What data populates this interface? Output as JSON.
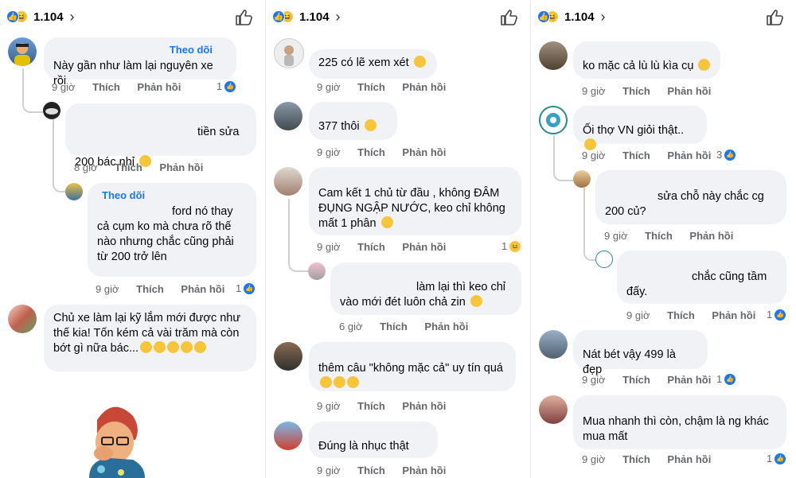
{
  "reaction_count": "1.104",
  "follow_label": "Theo dõi",
  "actions": {
    "like": "Thích",
    "reply": "Phản hồi"
  },
  "panel1": {
    "c1": {
      "text": "Này gần như làm lại nguyên xe rồi",
      "time": "9 giờ",
      "likes": "1"
    },
    "c1r1": {
      "text": "tiền sửa\n200 bác nhỉ",
      "time": "8 giờ"
    },
    "c1r2": {
      "text": "ford nó thay cả cụm ko mà chưa rõ thế nào nhưng chắc cũng phải từ 200 trở lên",
      "time": "9 giờ",
      "likes": "1"
    },
    "c2": {
      "text": "Chủ xe làm lại kỹ lắm mới được như thế kia! Tốn kém cả vài trăm mà còn bớt gì nữa bác..."
    }
  },
  "panel2": {
    "c1": {
      "text": "225 có lẽ xem xét",
      "time": "9 giờ"
    },
    "c2": {
      "text": "377 thôi",
      "time": "9 giờ"
    },
    "c3": {
      "text": "Cam kết 1 chủ từ đầu , không ĐÂM ĐỤNG NGẬP NƯỚC, keo chỉ không mất 1 phân",
      "time": "9 giờ",
      "likes": "1"
    },
    "c3r1": {
      "text": "làm lại thì keo chỉ vào mới đét luôn chả zin",
      "time": "6 giờ"
    },
    "c4": {
      "text": "thêm câu \"không mặc cả\" uy tín quá",
      "time": "9 giờ"
    },
    "c5": {
      "text": "Đúng là nhục thật",
      "time": "9 giờ"
    }
  },
  "panel3": {
    "c1": {
      "text": "ko mặc cả lù lù kìa cụ",
      "time": "9 giờ"
    },
    "c2": {
      "text": "Ối thợ VN giỏi thật..",
      "time": "9 giờ",
      "likes": "3"
    },
    "c2r1": {
      "text": "sửa chỗ này chắc cg 200 củ?",
      "time": "9 giờ"
    },
    "c2r2": {
      "text": "chắc cũng tầm đấy.",
      "time": "9 giờ",
      "likes": "1"
    },
    "c3": {
      "text": "Nát bét vậy 499 là đẹp",
      "time": "9 giờ",
      "likes": "1"
    },
    "c4": {
      "text": "Mua nhanh thì còn, chậm là ng khác mua mất",
      "time": "9 giờ",
      "likes": "1"
    }
  },
  "colors": {
    "accent": "#1877f2",
    "bubble": "#f0f2f5",
    "meta": "#65676b",
    "haha": "#f7c53a"
  },
  "icons": [
    "like-reaction-icon",
    "haha-reaction-icon",
    "chevron-right-icon",
    "thumbs-up-icon"
  ]
}
